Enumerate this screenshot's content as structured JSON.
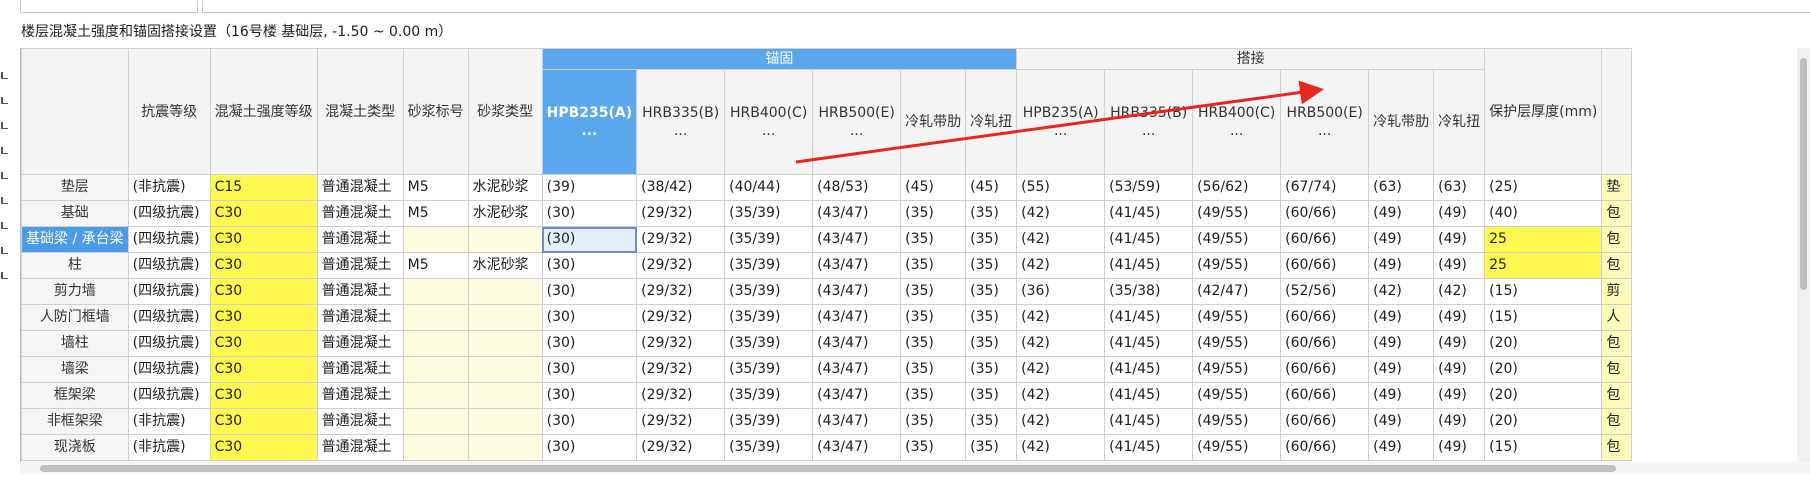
{
  "title": "楼层混凝土强度和锚固搭接设置（16号楼  基础层, -1.50 ~ 0.00 m）",
  "groups": {
    "anchor": "锚固",
    "lap": "搭接"
  },
  "columns": {
    "seismic": "抗震等级",
    "concrete_grade": "混凝土强度等级",
    "concrete_type": "混凝土类型",
    "mortar_grade": "砂浆标号",
    "mortar_type": "砂浆类型",
    "anchor_hpb235": "HPB235(A)",
    "anchor_hrb335": "HRB335(B)",
    "anchor_hrb400": "HRB400(C)",
    "anchor_hrb500": "HRB500(E)",
    "anchor_lrd": "冷轧带肋",
    "anchor_lrn": "冷轧扭",
    "lap_hpb235": "HPB235(A)",
    "lap_hrb335": "HRB335(B)",
    "lap_hrb400": "HRB400(C)",
    "lap_hrb500": "HRB500(E)",
    "lap_lrd": "冷轧带肋",
    "lap_lrn": "冷轧扭",
    "cover": "保护层厚度(mm)",
    "ellipsis": "..."
  },
  "rows": [
    {
      "name": "垫层",
      "seismic": "(非抗震)",
      "grade": "C15",
      "ctype": "普通混凝土",
      "mortar": "M5",
      "mtype": "水泥砂浆",
      "a1": "(39)",
      "a2": "(38/42)",
      "a3": "(40/44)",
      "a4": "(48/53)",
      "a5": "(45)",
      "a6": "(45)",
      "l1": "(55)",
      "l2": "(53/59)",
      "l3": "(56/62)",
      "l4": "(67/74)",
      "l5": "(63)",
      "l6": "(63)",
      "cover": "(25)",
      "note": "垫"
    },
    {
      "name": "基础",
      "seismic": "(四级抗震)",
      "grade": "C30",
      "ctype": "普通混凝土",
      "mortar": "M5",
      "mtype": "水泥砂浆",
      "a1": "(30)",
      "a2": "(29/32)",
      "a3": "(35/39)",
      "a4": "(43/47)",
      "a5": "(35)",
      "a6": "(35)",
      "l1": "(42)",
      "l2": "(41/45)",
      "l3": "(49/55)",
      "l4": "(60/66)",
      "l5": "(49)",
      "l6": "(49)",
      "cover": "(40)",
      "note": "包"
    },
    {
      "name": "基础梁 / 承台梁",
      "seismic": "(四级抗震)",
      "grade": "C30",
      "ctype": "普通混凝土",
      "mortar": "",
      "mtype": "",
      "a1": "(30)",
      "a2": "(29/32)",
      "a3": "(35/39)",
      "a4": "(43/47)",
      "a5": "(35)",
      "a6": "(35)",
      "l1": "(42)",
      "l2": "(41/45)",
      "l3": "(49/55)",
      "l4": "(60/66)",
      "l5": "(49)",
      "l6": "(49)",
      "cover": "25",
      "note": "包"
    },
    {
      "name": "柱",
      "seismic": "(四级抗震)",
      "grade": "C30",
      "ctype": "普通混凝土",
      "mortar": "M5",
      "mtype": "水泥砂浆",
      "a1": "(30)",
      "a2": "(29/32)",
      "a3": "(35/39)",
      "a4": "(43/47)",
      "a5": "(35)",
      "a6": "(35)",
      "l1": "(42)",
      "l2": "(41/45)",
      "l3": "(49/55)",
      "l4": "(60/66)",
      "l5": "(49)",
      "l6": "(49)",
      "cover": "25",
      "note": "包"
    },
    {
      "name": "剪力墙",
      "seismic": "(四级抗震)",
      "grade": "C30",
      "ctype": "普通混凝土",
      "mortar": "",
      "mtype": "",
      "a1": "(30)",
      "a2": "(29/32)",
      "a3": "(35/39)",
      "a4": "(43/47)",
      "a5": "(35)",
      "a6": "(35)",
      "l1": "(36)",
      "l2": "(35/38)",
      "l3": "(42/47)",
      "l4": "(52/56)",
      "l5": "(42)",
      "l6": "(42)",
      "cover": "(15)",
      "note": "剪"
    },
    {
      "name": "人防门框墙",
      "seismic": "(四级抗震)",
      "grade": "C30",
      "ctype": "普通混凝土",
      "mortar": "",
      "mtype": "",
      "a1": "(30)",
      "a2": "(29/32)",
      "a3": "(35/39)",
      "a4": "(43/47)",
      "a5": "(35)",
      "a6": "(35)",
      "l1": "(42)",
      "l2": "(41/45)",
      "l3": "(49/55)",
      "l4": "(60/66)",
      "l5": "(49)",
      "l6": "(49)",
      "cover": "(15)",
      "note": "人"
    },
    {
      "name": "墙柱",
      "seismic": "(四级抗震)",
      "grade": "C30",
      "ctype": "普通混凝土",
      "mortar": "",
      "mtype": "",
      "a1": "(30)",
      "a2": "(29/32)",
      "a3": "(35/39)",
      "a4": "(43/47)",
      "a5": "(35)",
      "a6": "(35)",
      "l1": "(42)",
      "l2": "(41/45)",
      "l3": "(49/55)",
      "l4": "(60/66)",
      "l5": "(49)",
      "l6": "(49)",
      "cover": "(20)",
      "note": "包"
    },
    {
      "name": "墙梁",
      "seismic": "(四级抗震)",
      "grade": "C30",
      "ctype": "普通混凝土",
      "mortar": "",
      "mtype": "",
      "a1": "(30)",
      "a2": "(29/32)",
      "a3": "(35/39)",
      "a4": "(43/47)",
      "a5": "(35)",
      "a6": "(35)",
      "l1": "(42)",
      "l2": "(41/45)",
      "l3": "(49/55)",
      "l4": "(60/66)",
      "l5": "(49)",
      "l6": "(49)",
      "cover": "(20)",
      "note": "包"
    },
    {
      "name": "框架梁",
      "seismic": "(四级抗震)",
      "grade": "C30",
      "ctype": "普通混凝土",
      "mortar": "",
      "mtype": "",
      "a1": "(30)",
      "a2": "(29/32)",
      "a3": "(35/39)",
      "a4": "(43/47)",
      "a5": "(35)",
      "a6": "(35)",
      "l1": "(42)",
      "l2": "(41/45)",
      "l3": "(49/55)",
      "l4": "(60/66)",
      "l5": "(49)",
      "l6": "(49)",
      "cover": "(20)",
      "note": "包"
    },
    {
      "name": "非框架梁",
      "seismic": "(非抗震)",
      "grade": "C30",
      "ctype": "普通混凝土",
      "mortar": "",
      "mtype": "",
      "a1": "(30)",
      "a2": "(29/32)",
      "a3": "(35/39)",
      "a4": "(43/47)",
      "a5": "(35)",
      "a6": "(35)",
      "l1": "(42)",
      "l2": "(41/45)",
      "l3": "(49/55)",
      "l4": "(60/66)",
      "l5": "(49)",
      "l6": "(49)",
      "cover": "(20)",
      "note": "包"
    },
    {
      "name": "现浇板",
      "seismic": "(非抗震)",
      "grade": "C30",
      "ctype": "普通混凝土",
      "mortar": "",
      "mtype": "",
      "a1": "(30)",
      "a2": "(29/32)",
      "a3": "(35/39)",
      "a4": "(43/47)",
      "a5": "(35)",
      "a6": "(35)",
      "l1": "(42)",
      "l2": "(41/45)",
      "l3": "(49/55)",
      "l4": "(60/66)",
      "l5": "(49)",
      "l6": "(49)",
      "cover": "(15)",
      "note": "包"
    }
  ],
  "selection": {
    "row": "基础梁 / 承台梁",
    "column": "HPB235(A)"
  },
  "annotation": {
    "shape": "red-arrow",
    "color": "#e8251f"
  },
  "colors": {
    "header_selected": "#5aa7ee",
    "highlight_yellow": "#fff94f",
    "pale_yellow": "#fffde0"
  }
}
